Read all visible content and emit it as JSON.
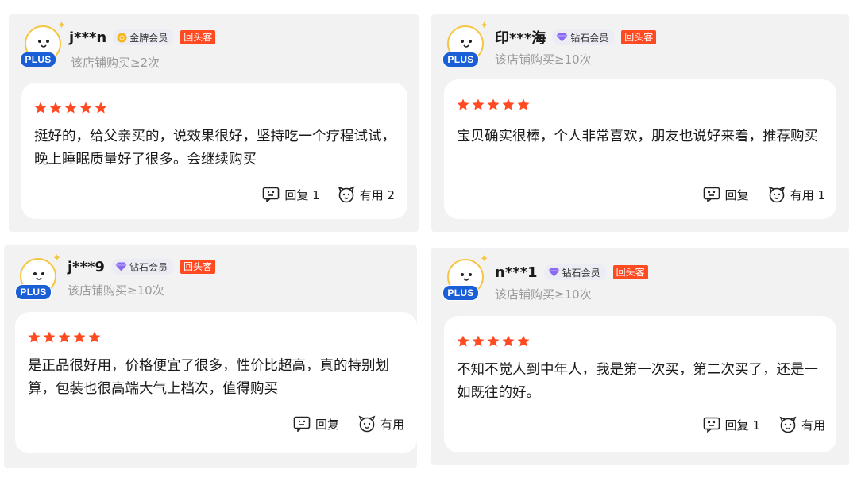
{
  "colors": {
    "star": "#ff4a22",
    "return_badge": "#ff4a22",
    "plus_badge": "#1a5fd6",
    "panel_bg": "#f2f2f2",
    "card_bg": "#ffffff"
  },
  "reviews": [
    {
      "avatar_badge": "PLUS",
      "username": "j***n",
      "member_icon": "gold-medal-icon",
      "member_level": "金牌会员",
      "return_badge": "回头客",
      "purchase_count": "该店铺购买≥2次",
      "rating": 5,
      "text": "挺好的，给父亲买的，说效果很好，坚持吃一个疗程试试，晚上睡眠质量好了很多。会继续购买",
      "reply_label": "回复 1",
      "useful_label": "有用 2"
    },
    {
      "avatar_badge": "PLUS",
      "username": "印***海",
      "member_icon": "diamond-icon",
      "member_level": "钻石会员",
      "return_badge": "回头客",
      "purchase_count": "该店铺购买≥10次",
      "rating": 5,
      "text": "宝贝确实很棒，个人非常喜欢，朋友也说好来着，推荐购买",
      "reply_label": "回复",
      "useful_label": "有用 1"
    },
    {
      "avatar_badge": "PLUS",
      "username": "j***9",
      "member_icon": "diamond-icon",
      "member_level": "钻石会员",
      "return_badge": "回头客",
      "purchase_count": "该店铺购买≥10次",
      "rating": 5,
      "text": "是正品很好用，价格便宜了很多，性价比超高，真的特别划算，包装也很高端大气上档次，值得购买",
      "reply_label": "回复",
      "useful_label": "有用"
    },
    {
      "avatar_badge": "PLUS",
      "username": "n***1",
      "member_icon": "diamond-icon",
      "member_level": "钻石会员",
      "return_badge": "回头客",
      "purchase_count": "该店铺购买≥10次",
      "rating": 5,
      "text": "不知不觉人到中年人，我是第一次买，第二次买了，还是一如既往的好。",
      "reply_label": "回复 1",
      "useful_label": "有用"
    }
  ]
}
